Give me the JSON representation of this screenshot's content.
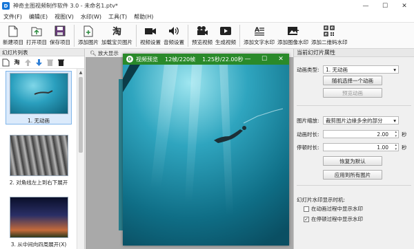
{
  "window": {
    "app_title": "神奇主图视频制作软件 3.0 - 未命名1.ptv*"
  },
  "menu": [
    "文件(F)",
    "编辑(E)",
    "视图(V)",
    "水印(W)",
    "工具(T)",
    "帮助(H)"
  ],
  "toolbar": [
    {
      "label": "新建项目",
      "icon": "new-project-icon"
    },
    {
      "label": "打开项目",
      "icon": "open-project-icon"
    },
    {
      "label": "保存项目",
      "icon": "save-project-icon"
    },
    {
      "label": "添加图片",
      "icon": "add-image-icon"
    },
    {
      "label": "加载宝贝图片",
      "icon": "load-taobao-icon"
    },
    {
      "label": "视频设置",
      "icon": "video-settings-icon"
    },
    {
      "label": "音频设置",
      "icon": "audio-settings-icon"
    },
    {
      "label": "预览视频",
      "icon": "preview-video-icon"
    },
    {
      "label": "生成视频",
      "icon": "generate-video-icon"
    },
    {
      "label": "添加文字水印",
      "icon": "text-watermark-icon"
    },
    {
      "label": "添加图像水印",
      "icon": "image-watermark-icon"
    },
    {
      "label": "添加二维码水印",
      "icon": "qrcode-watermark-icon"
    }
  ],
  "left_panel": {
    "title": "幻灯片列表",
    "slides": [
      {
        "caption": "1. 无动画"
      },
      {
        "caption": "2. 对角线左上到右下展开"
      },
      {
        "caption": "3. 从中间向四周展开(X)"
      }
    ]
  },
  "center_toolbar": {
    "zoom_in": "放大显示"
  },
  "preview_window": {
    "title": "视频预览",
    "frames": "12帧/220帧",
    "time": "1.25秒/22.00秒"
  },
  "right_panel": {
    "title": "当前幻灯片属性",
    "anim_type_label": "动画类型:",
    "anim_type_value": "1. 无动画",
    "random_anim_btn": "随机选择一个动画",
    "preview_anim_btn": "预览动画",
    "scale_label": "图片缩放:",
    "scale_value": "裁剪图片边缘多余的部分",
    "anim_duration_label": "动画时长:",
    "anim_duration_value": "2.00",
    "pause_duration_label": "停顿时长:",
    "pause_duration_value": "1.00",
    "unit_seconds": "秒",
    "restore_default_btn": "恢复为默认",
    "apply_all_btn": "应用到所有图片",
    "watermark_title": "幻灯片水印显示时机:",
    "wm_during_anim": "在动画过程中显示水印",
    "wm_during_anim_checked": false,
    "wm_during_pause": "在停顿过程中显示水印",
    "wm_during_pause_checked": true
  },
  "colors": {
    "preview_bar": "#2a8a2a",
    "accent": "#1677d9",
    "selection": "#dbeafb"
  }
}
